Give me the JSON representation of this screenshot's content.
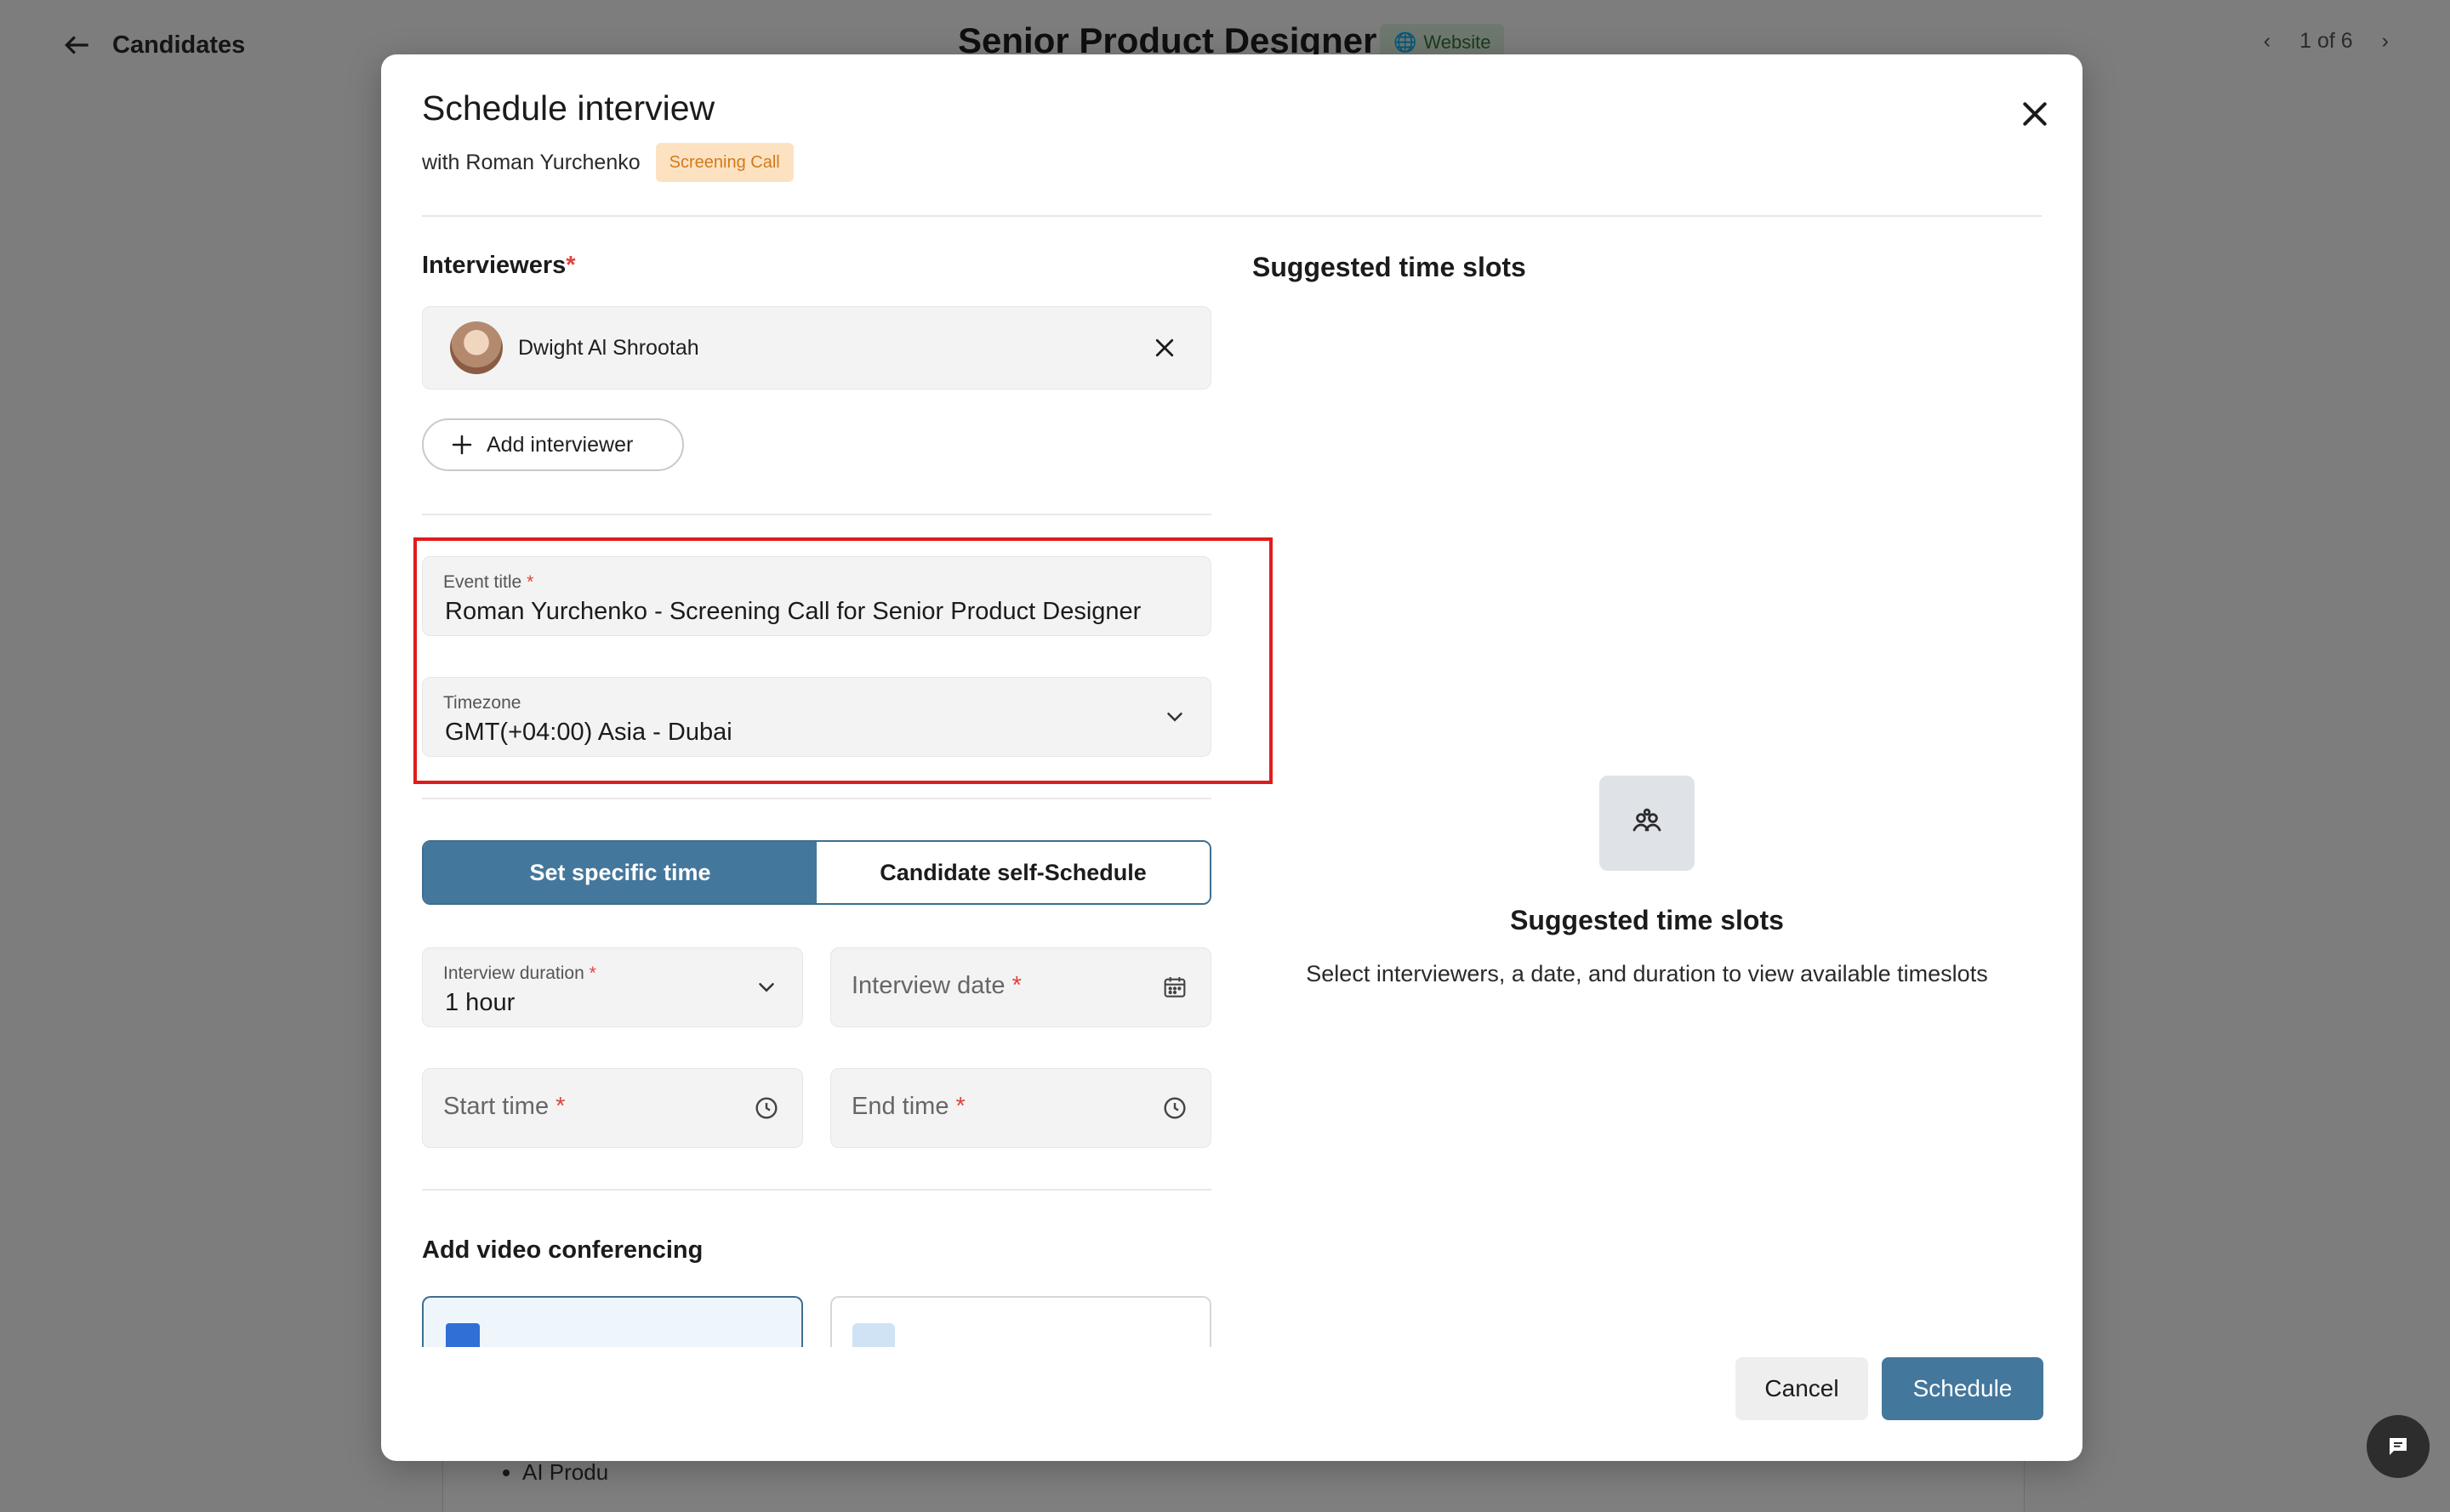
{
  "background": {
    "back_label": "Candidates",
    "job_title": "Senior Product Designer",
    "source_badge": "Website",
    "pager": "1 of 6",
    "list_item": "AI Produ"
  },
  "modal": {
    "title": "Schedule interview",
    "with_text": "with Roman Yurchenko",
    "stage_badge": "Screening Call",
    "interviewers_label": "Interviewers",
    "required_mark": "*",
    "interviewers": [
      {
        "name": "Dwight Al Shrootah"
      }
    ],
    "add_interviewer_label": "Add interviewer",
    "event_title": {
      "label": "Event title",
      "value": "Roman Yurchenko - Screening Call for Senior Product Designer"
    },
    "timezone": {
      "label": "Timezone",
      "value": "GMT(+04:00) Asia - Dubai"
    },
    "schedule_mode": {
      "options": [
        "Set specific time",
        "Candidate self-Schedule"
      ],
      "selected": "Set specific time"
    },
    "duration": {
      "label": "Interview duration",
      "value": "1 hour"
    },
    "date": {
      "placeholder": "Interview date"
    },
    "start_time": {
      "placeholder": "Start time"
    },
    "end_time": {
      "placeholder": "End time"
    },
    "video_label": "Add video conferencing",
    "suggested": {
      "header": "Suggested time slots",
      "empty_title": "Suggested time slots",
      "empty_desc": "Select interviewers, a date, and duration to view available timeslots"
    },
    "cancel_label": "Cancel",
    "schedule_label": "Schedule"
  },
  "colors": {
    "primary": "#44779c",
    "required": "#e0433c",
    "highlight": "#e01b1b",
    "stage_badge_bg": "#fde2c2",
    "stage_badge_text": "#d27a1a"
  }
}
